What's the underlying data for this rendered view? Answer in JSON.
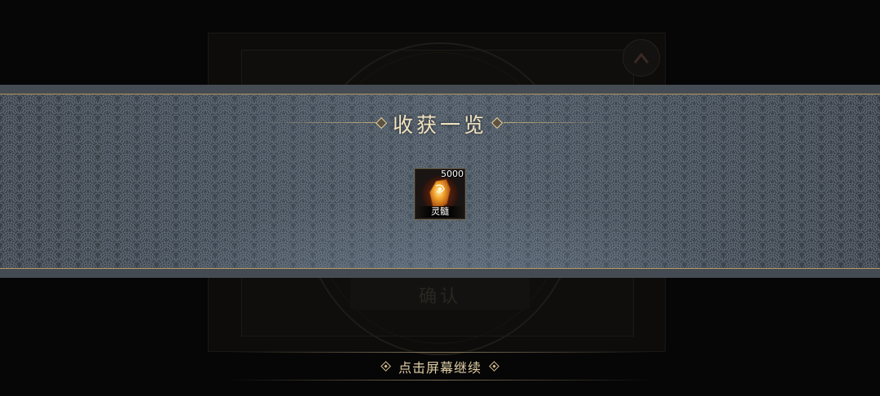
{
  "background_dialog": {
    "title": "",
    "confirm_label": "确认"
  },
  "rewards_panel": {
    "title": "收获一览",
    "items": [
      {
        "name": "灵髓",
        "count": "5000",
        "icon": "amber-crystal-icon"
      }
    ]
  },
  "footer": {
    "hint": "点击屏幕继续"
  },
  "colors": {
    "gold_accent": "#c8af78",
    "title_text": "#f1e2bf",
    "banner_blue": "#4a5560"
  }
}
